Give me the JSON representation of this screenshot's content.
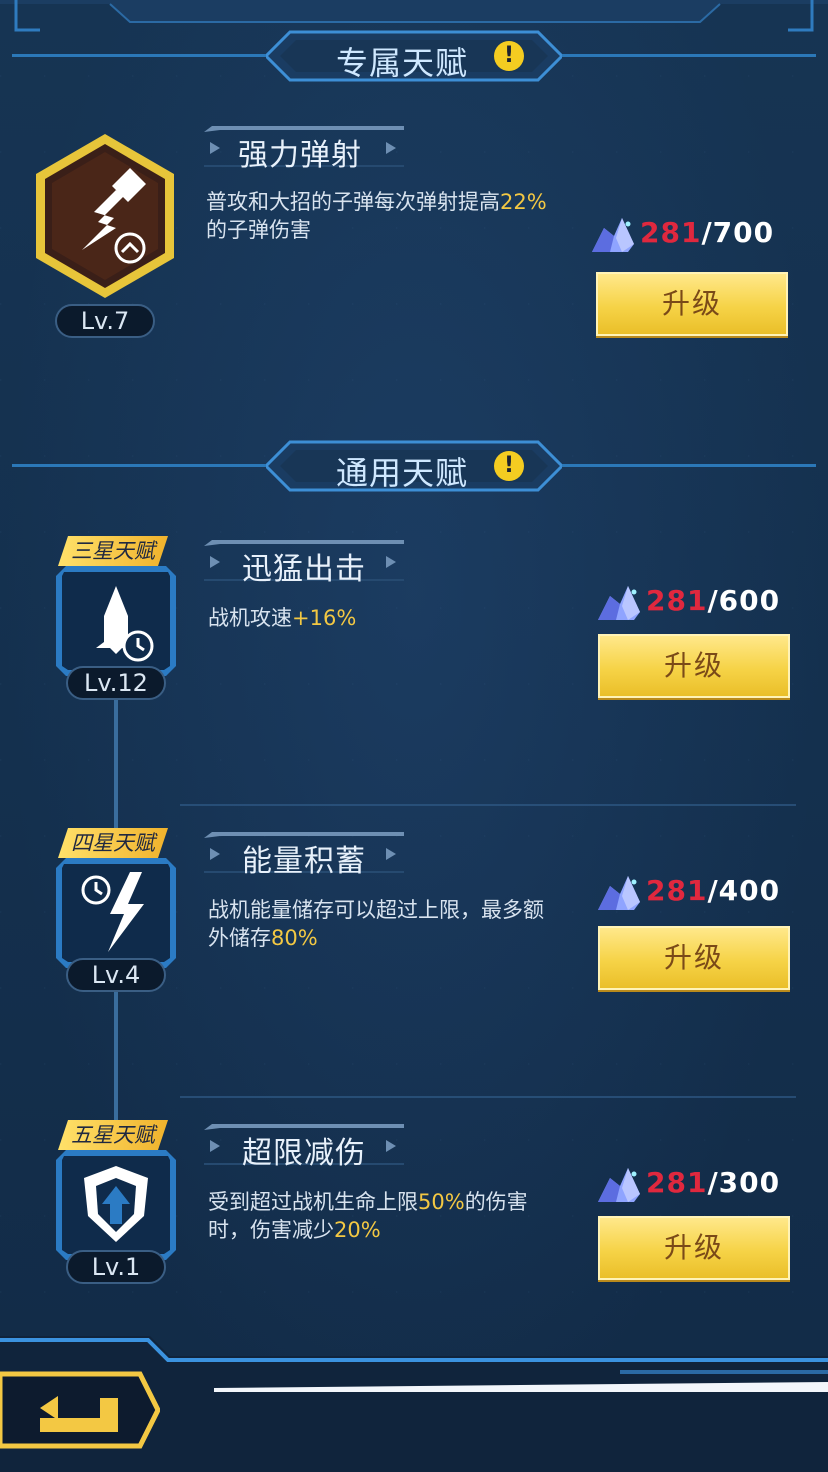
{
  "exclusive_section": {
    "title": "专属天赋",
    "warn": "!"
  },
  "general_section": {
    "title": "通用天赋",
    "warn": "!"
  },
  "exclusive_talent": {
    "name": "强力弹射",
    "desc_pre": "普攻和大招的子弹每次弹射提高",
    "desc_hl": "22%",
    "desc_post": "的子弹伤害",
    "level": "Lv.7",
    "cost_current": "281",
    "cost_total": "/700",
    "button": "升级",
    "icon": "bouncing-bullet-icon"
  },
  "general_talents": [
    {
      "star_tag": "三星天赋",
      "name": "迅猛出击",
      "desc_pre": "战机攻速",
      "desc_hl": "+16%",
      "desc_post": "",
      "level": "Lv.12",
      "cost_current": "281",
      "cost_total": "/600",
      "button": "升级",
      "icon": "jet-speed-icon"
    },
    {
      "star_tag": "四星天赋",
      "name": "能量积蓄",
      "desc_pre": "战机能量储存可以超过上限，最多额外储存",
      "desc_hl": "80%",
      "desc_post": "",
      "level": "Lv.4",
      "cost_current": "281",
      "cost_total": "/400",
      "button": "升级",
      "icon": "lightning-timer-icon"
    },
    {
      "star_tag": "五星天赋",
      "name": "超限减伤",
      "desc_pre": "受到超过战机生命上限",
      "desc_hl": "50%",
      "desc_mid": "的伤害时，伤害减少",
      "desc_hl2": "20%",
      "level": "Lv.1",
      "cost_current": "281",
      "cost_total": "/300",
      "button": "升级",
      "icon": "shield-up-icon"
    }
  ],
  "colors": {
    "accent": "#f3c843",
    "cost_current": "#e0283e",
    "button": "#f6d347"
  }
}
